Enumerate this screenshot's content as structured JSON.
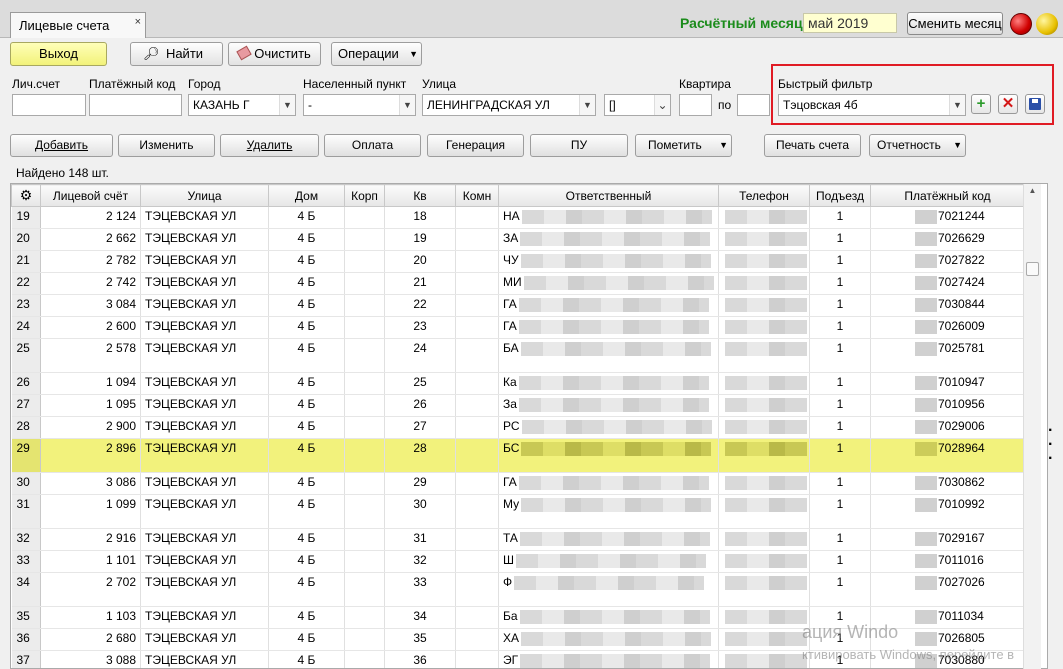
{
  "tab": {
    "title": "Лицевые счета",
    "close": "×"
  },
  "header": {
    "month_label": "Расчётный месяц",
    "month_value": "май 2019",
    "change_month": "Сменить месяц"
  },
  "toolbar": {
    "exit": "Выход",
    "find": "Найти",
    "clear": "Очистить",
    "operations": "Операции"
  },
  "filters": {
    "account_label": "Лич.счет",
    "account_value": "",
    "paycode_label": "Платёжный код",
    "paycode_value": "",
    "city_label": "Город",
    "city_value": "КАЗАНЬ Г",
    "settlement_label": "Населенный пункт",
    "settlement_value": "-",
    "street_label": "Улица",
    "street_value": "ЛЕНИНГРАДСКАЯ УЛ",
    "house_value": "[]",
    "flat_label": "Квартира",
    "flat_to": "по",
    "quick_label": "Быстрый фильтр",
    "quick_value": "Тэцовская 4б"
  },
  "actions": {
    "add": "Добавить",
    "edit": "Изменить",
    "delete": "Удалить",
    "payment": "Оплата",
    "generation": "Генерация",
    "pu": "ПУ",
    "mark": "Пометить",
    "print": "Печать счета",
    "reports": "Отчетность"
  },
  "found_text": "Найдено 148 шт.",
  "grid": {
    "columns": [
      "Лицевой счёт",
      "Улица",
      "Дом",
      "Корп",
      "Кв",
      "Комн",
      "Ответственный",
      "Телефон",
      "Подъезд",
      "Платёжный код"
    ],
    "rows": [
      {
        "n": "19",
        "acc": "2 124",
        "street": "ТЭЦЕВСКАЯ УЛ",
        "house": "4 Б",
        "corp": "",
        "flat": "18",
        "room": "",
        "resp": "НА",
        "phone": "",
        "entr": "1",
        "code": "7021244",
        "tall": false,
        "sel": false
      },
      {
        "n": "20",
        "acc": "2 662",
        "street": "ТЭЦЕВСКАЯ УЛ",
        "house": "4 Б",
        "corp": "",
        "flat": "19",
        "room": "",
        "resp": "ЗА",
        "phone": "",
        "entr": "1",
        "code": "7026629",
        "tall": false,
        "sel": false
      },
      {
        "n": "21",
        "acc": "2 782",
        "street": "ТЭЦЕВСКАЯ УЛ",
        "house": "4 Б",
        "corp": "",
        "flat": "20",
        "room": "",
        "resp": "ЧУ",
        "phone": "",
        "entr": "1",
        "code": "7027822",
        "tall": false,
        "sel": false
      },
      {
        "n": "22",
        "acc": "2 742",
        "street": "ТЭЦЕВСКАЯ УЛ",
        "house": "4 Б",
        "corp": "",
        "flat": "21",
        "room": "",
        "resp": "МИ",
        "phone": "",
        "entr": "1",
        "code": "7027424",
        "tall": false,
        "sel": false
      },
      {
        "n": "23",
        "acc": "3 084",
        "street": "ТЭЦЕВСКАЯ УЛ",
        "house": "4 Б",
        "corp": "",
        "flat": "22",
        "room": "",
        "resp": "ГА",
        "phone": "",
        "entr": "1",
        "code": "7030844",
        "tall": false,
        "sel": false
      },
      {
        "n": "24",
        "acc": "2 600",
        "street": "ТЭЦЕВСКАЯ УЛ",
        "house": "4 Б",
        "corp": "",
        "flat": "23",
        "room": "",
        "resp": "ГА",
        "phone": "",
        "entr": "1",
        "code": "7026009",
        "tall": false,
        "sel": false
      },
      {
        "n": "25",
        "acc": "2 578",
        "street": "ТЭЦЕВСКАЯ УЛ",
        "house": "4 Б",
        "corp": "",
        "flat": "24",
        "room": "",
        "resp": "БА",
        "phone": "",
        "entr": "1",
        "code": "7025781",
        "tall": true,
        "sel": false
      },
      {
        "n": "26",
        "acc": "1 094",
        "street": "ТЭЦЕВСКАЯ УЛ",
        "house": "4 Б",
        "corp": "",
        "flat": "25",
        "room": "",
        "resp": "Ка",
        "phone": "",
        "entr": "1",
        "code": "7010947",
        "tall": false,
        "sel": false
      },
      {
        "n": "27",
        "acc": "1 095",
        "street": "ТЭЦЕВСКАЯ УЛ",
        "house": "4 Б",
        "corp": "",
        "flat": "26",
        "room": "",
        "resp": "За",
        "phone": "",
        "entr": "1",
        "code": "7010956",
        "tall": false,
        "sel": false
      },
      {
        "n": "28",
        "acc": "2 900",
        "street": "ТЭЦЕВСКАЯ УЛ",
        "house": "4 Б",
        "corp": "",
        "flat": "27",
        "room": "",
        "resp": "РС",
        "phone": "",
        "entr": "1",
        "code": "7029006",
        "tall": false,
        "sel": false
      },
      {
        "n": "29",
        "acc": "2 896",
        "street": "ТЭЦЕВСКАЯ УЛ",
        "house": "4 Б",
        "corp": "",
        "flat": "28",
        "room": "",
        "resp": "БС",
        "phone": "",
        "entr": "1",
        "code": "7028964",
        "tall": true,
        "sel": true
      },
      {
        "n": "30",
        "acc": "3 086",
        "street": "ТЭЦЕВСКАЯ УЛ",
        "house": "4 Б",
        "corp": "",
        "flat": "29",
        "room": "",
        "resp": "ГА",
        "phone": "",
        "entr": "1",
        "code": "7030862",
        "tall": false,
        "sel": false
      },
      {
        "n": "31",
        "acc": "1 099",
        "street": "ТЭЦЕВСКАЯ УЛ",
        "house": "4 Б",
        "corp": "",
        "flat": "30",
        "room": "",
        "resp": "Му",
        "phone": "",
        "entr": "1",
        "code": "7010992",
        "tall": true,
        "sel": false
      },
      {
        "n": "32",
        "acc": "2 916",
        "street": "ТЭЦЕВСКАЯ УЛ",
        "house": "4 Б",
        "corp": "",
        "flat": "31",
        "room": "",
        "resp": "ТА",
        "phone": "",
        "entr": "1",
        "code": "7029167",
        "tall": false,
        "sel": false
      },
      {
        "n": "33",
        "acc": "1 101",
        "street": "ТЭЦЕВСКАЯ УЛ",
        "house": "4 Б",
        "corp": "",
        "flat": "32",
        "room": "",
        "resp": "Ш",
        "phone": "",
        "entr": "1",
        "code": "7011016",
        "tall": false,
        "sel": false
      },
      {
        "n": "34",
        "acc": "2 702",
        "street": "ТЭЦЕВСКАЯ УЛ",
        "house": "4 Б",
        "corp": "",
        "flat": "33",
        "room": "",
        "resp": "Ф",
        "phone": "",
        "entr": "1",
        "code": "7027026",
        "tall": true,
        "sel": false
      },
      {
        "n": "35",
        "acc": "1 103",
        "street": "ТЭЦЕВСКАЯ УЛ",
        "house": "4 Б",
        "corp": "",
        "flat": "34",
        "room": "",
        "resp": "Ба",
        "phone": "",
        "entr": "1",
        "code": "7011034",
        "tall": false,
        "sel": false
      },
      {
        "n": "36",
        "acc": "2 680",
        "street": "ТЭЦЕВСКАЯ УЛ",
        "house": "4 Б",
        "corp": "",
        "flat": "35",
        "room": "",
        "resp": "ХА",
        "phone": "",
        "entr": "1",
        "code": "7026805",
        "tall": false,
        "sel": false
      },
      {
        "n": "37",
        "acc": "3 088",
        "street": "ТЭЦЕВСКАЯ УЛ",
        "house": "4 Б",
        "corp": "",
        "flat": "36",
        "room": "",
        "resp": "ЭГ",
        "phone": "",
        "entr": "1",
        "code": "7030880",
        "tall": false,
        "sel": false
      }
    ]
  },
  "watermark": {
    "line1": "ация Windo",
    "line2": "ктивировать Windows, перейдите в"
  },
  "colors": {
    "accent_green": "#1c8c1c",
    "selected_row": "#f2f27c",
    "highlight_red": "#e01b24",
    "exit_button": "#f2f27a"
  },
  "icons": {
    "find": "magnifier-icon",
    "clear": "eraser-icon",
    "settings": "gear-icon",
    "add": "plus-icon",
    "remove": "cross-icon",
    "save": "floppy-icon"
  }
}
